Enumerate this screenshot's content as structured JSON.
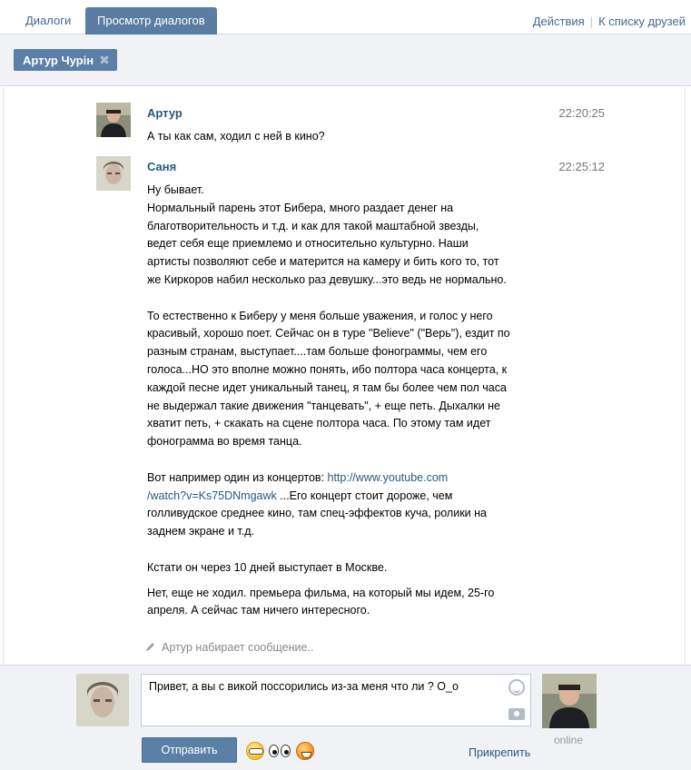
{
  "tabs": {
    "dialogs": "Диалоги",
    "view": "Просмотр диалогов",
    "actions": "Действия",
    "separator": "|",
    "friends": "К списку друзей"
  },
  "recipient": {
    "name": "Артур Чурін",
    "remove": "✖"
  },
  "messages": [
    {
      "author": "Артур",
      "time": "22:20:25",
      "lines": [
        "А ты как сам, ходил с ней в кино?"
      ]
    },
    {
      "author": "Саня",
      "time": "22:25:12",
      "p1": "Ну бывает.",
      "p2": "Нормальный парень этот Бибера, много раздает денег на благотворительность и т.д. и как для такой маштабной звезды, ведет себя еще приемлемо и относительно культурно. Наши артисты позволяют себе и матерится на камеру и бить кого то, тот же Киркоров набил несколько раз девушку...это ведь не нормально.",
      "p3": "То естественно к Биберу у меня больше уважения, и голос у него красивый, хорошо поет. Сейчас он в туре \"Believe\" (\"Верь\"), ездит по разным странам, выступает....там больше фонограммы, чем его голоса...НО это вполне можно понять, ибо полтора часа концерта, к каждой песне идет уникальный танец, я там бы более чем пол часа не выдержал такие движения \"танцевать\", + еще петь. Дыхалки не хватит петь, + скакать на сцене полтора часа. По этому там идет фонограмма во время танца.",
      "p4_prefix": "Вот например один из концертов: ",
      "p4_link_1": "http://www.youtube.com",
      "p4_link_2": "/watch?v=Ks75DNmgawk",
      "p4_suffix": " ...Его концерт стоит дороже, чем голливудское среднее кино, там спец-эффектов куча, ролики на заднем экране и т.д.",
      "p5": "Кстати он через 10 дней выступает в Москве.",
      "p6": "Нет, еще не ходил. премьера фильма, на который мы идем, 25-го апреля. А сейчас там ничего интересного."
    }
  ],
  "typing": "Артур набирает сообщение..",
  "composer": {
    "text": "Привет, а вы с викой поссорились из-за меня что ли ? О_о",
    "send": "Отправить",
    "attach": "Прикрепить",
    "online": "online"
  }
}
